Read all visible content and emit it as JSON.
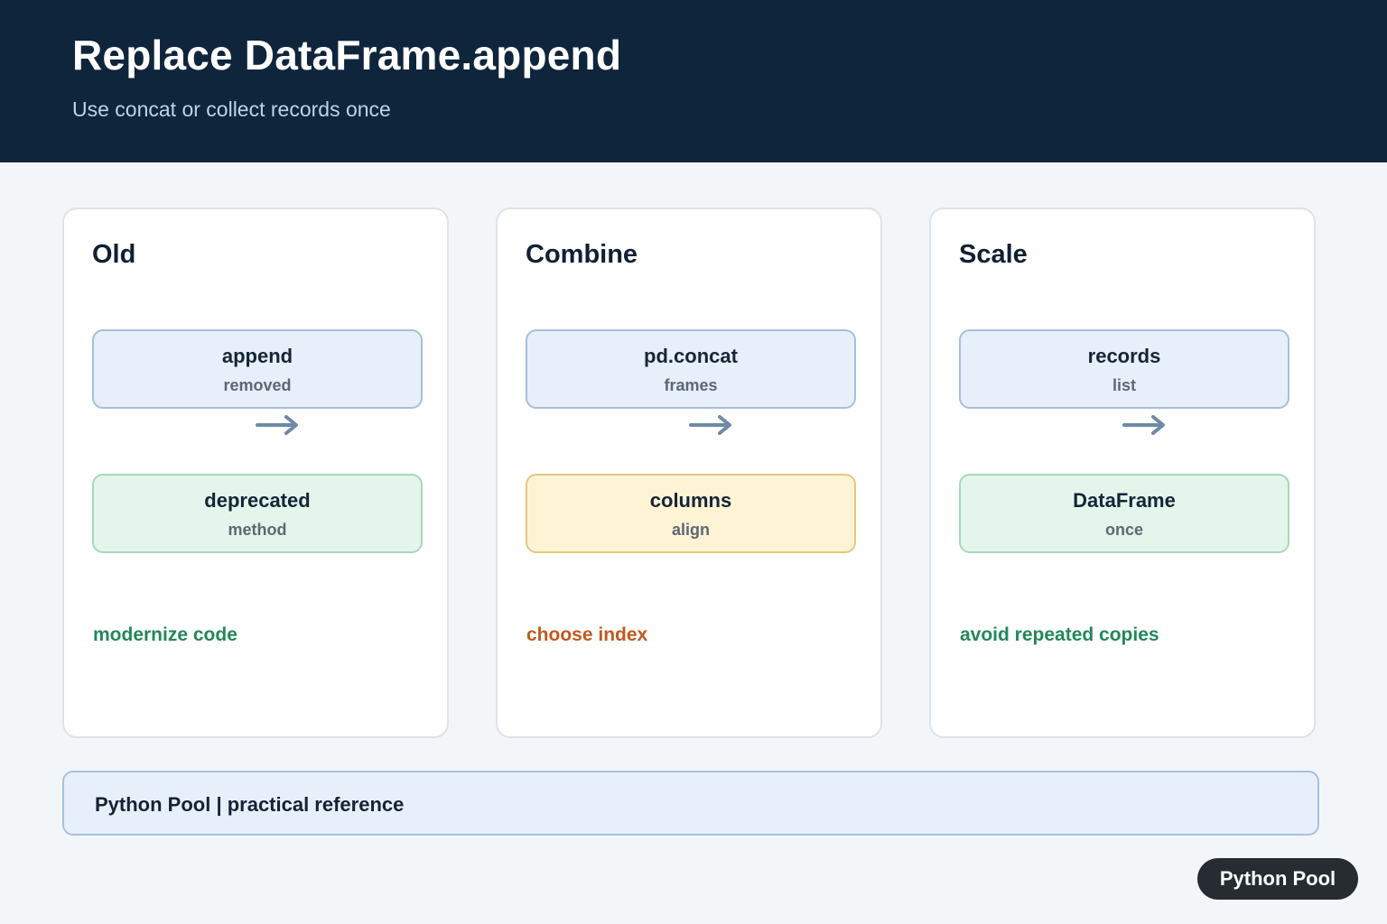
{
  "header": {
    "title": "Replace DataFrame.append",
    "subtitle": "Use concat or collect records once"
  },
  "colors": {
    "header_bg": "#0f253b",
    "box_blue": "#e7effa",
    "box_green": "#e4f5ec",
    "box_yellow": "#fff3d5",
    "arrow": "#6f89a6",
    "note_green": "#23875a",
    "note_orange": "#c05a1f"
  },
  "cards": [
    {
      "title": "Old",
      "top_box": {
        "label": "append",
        "sub": "removed",
        "color": "blue"
      },
      "arrow_icon": "arrow-right-icon",
      "bottom_box": {
        "label": "deprecated",
        "sub": "method",
        "color": "green"
      },
      "note": "modernize code",
      "note_color": "#23875a"
    },
    {
      "title": "Combine",
      "top_box": {
        "label": "pd.concat",
        "sub": "frames",
        "color": "blue"
      },
      "arrow_icon": "arrow-right-icon",
      "bottom_box": {
        "label": "columns",
        "sub": "align",
        "color": "yellow"
      },
      "note": "choose index",
      "note_color": "#c05a1f"
    },
    {
      "title": "Scale",
      "top_box": {
        "label": "records",
        "sub": "list",
        "color": "blue"
      },
      "arrow_icon": "arrow-right-icon",
      "bottom_box": {
        "label": "DataFrame",
        "sub": "once",
        "color": "green"
      },
      "note": "avoid repeated copies",
      "note_color": "#23875a"
    }
  ],
  "footer": {
    "text": "Python Pool | practical reference"
  },
  "brand": {
    "label": "Python Pool"
  }
}
